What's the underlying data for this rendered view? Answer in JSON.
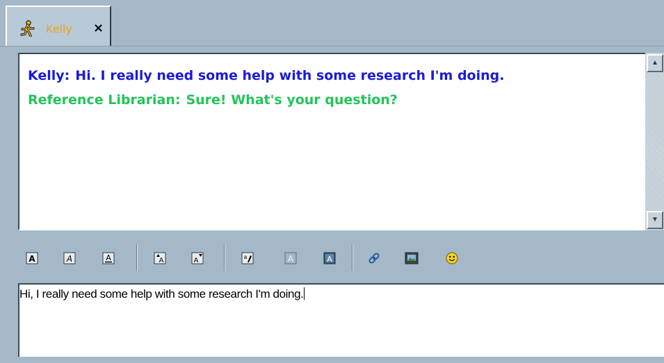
{
  "tab": {
    "icon": "aim-running-man-icon",
    "label": "Kelly",
    "close_glyph": "×",
    "label_color": "#e8a41a"
  },
  "transcript": {
    "messages": [
      {
        "sender": "Kelly:",
        "text": "Hi.  I really need some help with some research I'm doing.",
        "color": "#1a1ad8"
      },
      {
        "sender": "Reference Librarian:",
        "text": "Sure!  What's your question?",
        "color": "#22c458"
      }
    ]
  },
  "toolbar": {
    "buttons": [
      "bold-icon",
      "italic-icon",
      "underline-icon",
      "increase-font-size-icon",
      "decrease-font-size-icon",
      "text-color-icon",
      "background-color-icon",
      "font-style-icon",
      "insert-link-icon",
      "insert-image-icon",
      "smiley-icon"
    ]
  },
  "input": {
    "value": "Hi, I really need some help with some research I'm doing."
  }
}
